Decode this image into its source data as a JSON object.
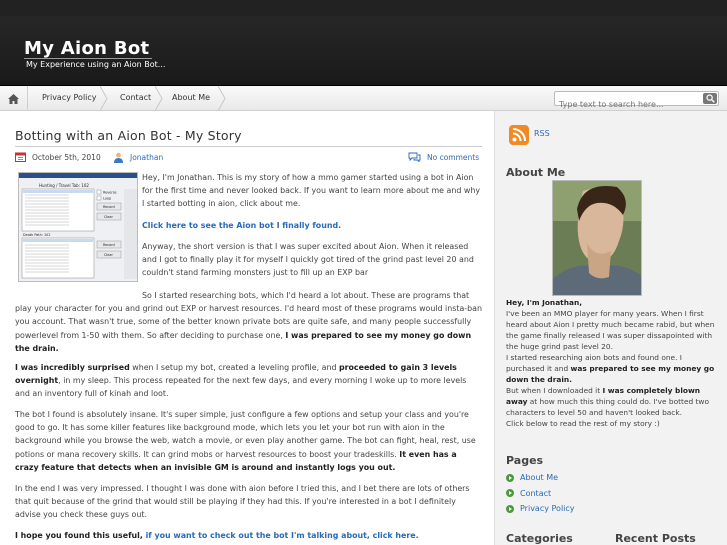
{
  "header": {
    "site_title": "My Aion Bot",
    "tagline": "My Experience using an Aion Bot..."
  },
  "nav": {
    "items": [
      "Privacy Policy",
      "Contact",
      "About Me"
    ],
    "search_placeholder": "Type text to search here..."
  },
  "post": {
    "title": "Botting with an Aion Bot - My Story",
    "date": "October 5th, 2010",
    "author": "Jonathan",
    "comments": "No comments",
    "p1": "Hey, I'm Jonathan. This is my story of how a mmo gamer started using a bot in Aion for the first time and never looked back. If you want to learn more about me and why I started botting in aion, click about me.",
    "link1": "Click here to see the Aion bot I finally found.",
    "p2": "Anyway, the short version is that I was super excited about Aion. When it released and I got to finally play it for myself I quickly got tired of the grind past level 20 and couldn't stand farming monsters just to fill up an EXP bar",
    "p3_start": "So I started researching bots, which I'd heard a lot about. These are programs that play your character for you and grind out EXP or harvest resources. I'd heard most of these programs would insta-ban you account. That wasn't true, some of the better known private bots are quite safe, and many people successfully powerlevel from 1-50 with them. So after deciding to purchase one, ",
    "p3_bold": "I was prepared to see my money go down the drain.",
    "p4_bold1": "I was incredibly surprised",
    "p4_mid1": " when I setup my bot, created a leveling profile, and ",
    "p4_bold2": "proceeded to gain 3 levels overnight",
    "p4_rest": ", in my sleep. This process repeated for the next few days, and every morning I woke up to more levels and an inventory full of kinah and loot.",
    "p5": "The bot I found is absolutely insane. It's super simple, just configure a few options and setup your class and you're good to go. It has some killer features like background mode, which lets you let your bot run with aion in the background while you browse the web, watch a movie, or even play another game. The bot can fight, heal, rest, use potions or mana recovery skills. It can grind mobs or harvest resources to boost your tradeskills. ",
    "p5_bold": "It even has a crazy feature that detects when an invisible GM is around and instantly logs you out.",
    "p6": "In the end I was very impressed. I thought I was done with aion before I tried this, and I bet there are lots of others that quit because of the grind that would still be playing if they had this. If you're interested in a bot I definitely advise you check these guys out.",
    "p7_bold": "I hope you found this useful, ",
    "p7_link": "if you want to check out the bot I'm talking about, click here."
  },
  "sidebar": {
    "rss": "RSS",
    "about_heading": "About Me",
    "about_name": "Hey, I'm Jonathan,",
    "about_t1": "I've been an MMO player for many years. When I first heard about Aion I pretty much became rabid, but when the game finally released I was super dissapointed with the huge grind past level 20.",
    "about_t2": "I started researching aion bots and found one. I purchased it and ",
    "about_b1": "was prepared to see my money go down the drain.",
    "about_t3": "But when I downloaded it ",
    "about_b2": "I was completely blown away",
    "about_t4": " at how much this thing could do. I've botted two characters to level 50 and haven't looked back.",
    "about_t5": "Click below to read the rest of my story :)",
    "pages_heading": "Pages",
    "pages": [
      "About Me",
      "Contact",
      "Privacy Policy"
    ],
    "categories_heading": "Categories",
    "recent_heading": "Recent Posts"
  },
  "bot_window": {
    "title": "Hunting / Travel Tab: 102",
    "death_label": "Death Path: 102",
    "buttons": [
      "Record",
      "Clear"
    ],
    "checks": [
      "Reverse",
      "Loop"
    ]
  },
  "colors": {
    "link": "#2a6ab8",
    "header_bg": "#1e1e1e",
    "sidebar_bg": "#f2f2f2",
    "bullet": "#4a9a3a",
    "rss": "#f08a24"
  }
}
